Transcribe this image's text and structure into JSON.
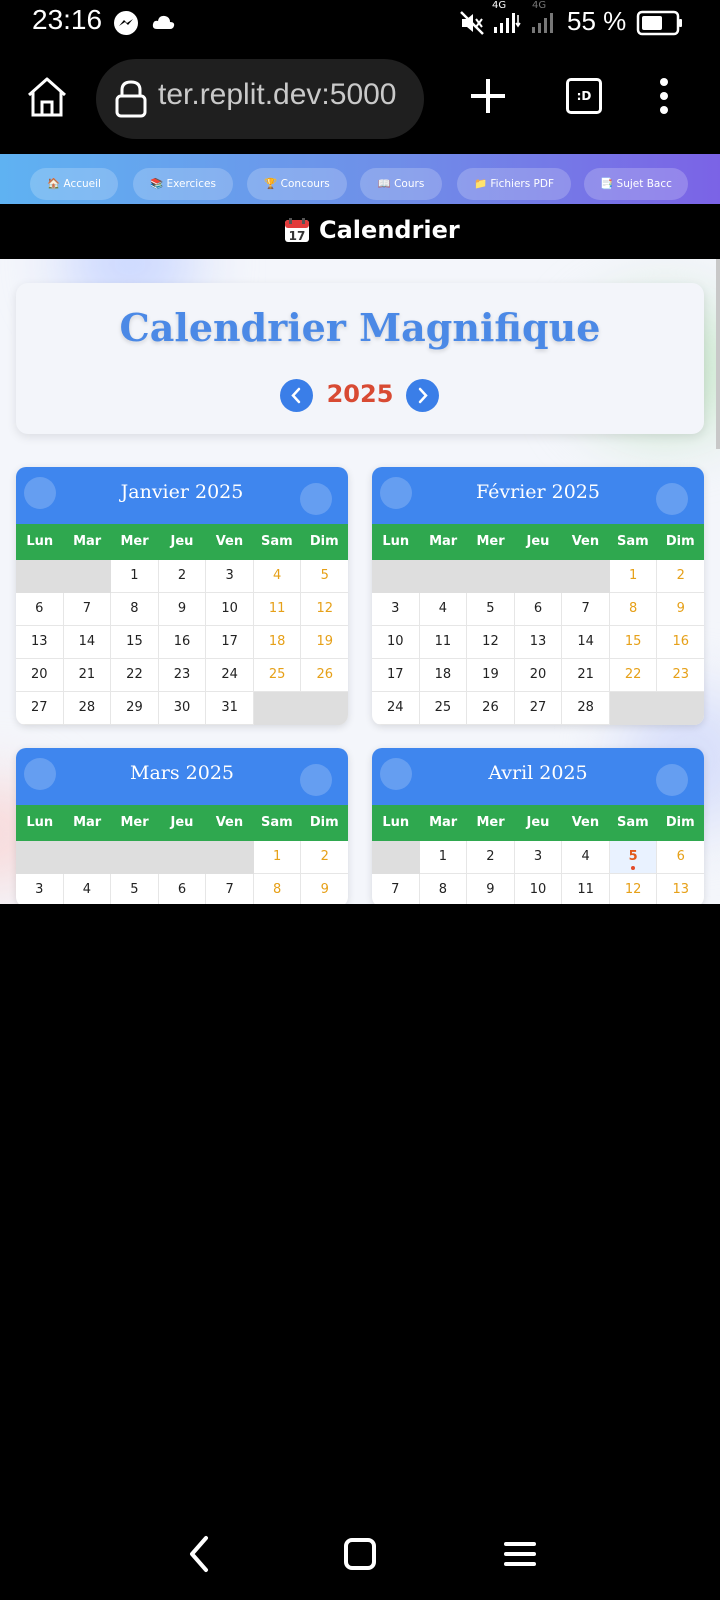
{
  "status_bar": {
    "time": "23:16",
    "battery_text": "55 %",
    "network_label_1": "4G",
    "network_label_2": "4G",
    "icons": [
      "messenger-icon",
      "cloud-icon",
      "mute-icon",
      "signal-icon",
      "battery-icon"
    ]
  },
  "browser": {
    "url": "ter.replit.dev:5000",
    "tabs_label": ":D",
    "icons": [
      "home-icon",
      "lock-icon",
      "plus-icon",
      "menu-dots-icon"
    ]
  },
  "site_nav": {
    "items": [
      {
        "label": "🏠 Accueil"
      },
      {
        "label": "📚 Exercices"
      },
      {
        "label": "🏆 Concours"
      },
      {
        "label": "📖 Cours"
      },
      {
        "label": "📁 Fichiers PDF"
      },
      {
        "label": "📑 Sujet Bacc"
      }
    ]
  },
  "page_title": "Calendrier",
  "calendar": {
    "title": "Calendrier Magnifique",
    "year": "2025",
    "weekdays": [
      "Lun",
      "Mar",
      "Mer",
      "Jeu",
      "Ven",
      "Sam",
      "Dim"
    ],
    "today_marker": {
      "month_index": 3,
      "day": "5"
    },
    "months": [
      {
        "name": "Janvier 2025",
        "weeks": [
          [
            "",
            "",
            "1",
            "2",
            "3",
            "4",
            "5"
          ],
          [
            "6",
            "7",
            "8",
            "9",
            "10",
            "11",
            "12"
          ],
          [
            "13",
            "14",
            "15",
            "16",
            "17",
            "18",
            "19"
          ],
          [
            "20",
            "21",
            "22",
            "23",
            "24",
            "25",
            "26"
          ],
          [
            "27",
            "28",
            "29",
            "30",
            "31",
            "",
            ""
          ]
        ]
      },
      {
        "name": "Février 2025",
        "weeks": [
          [
            "",
            "",
            "",
            "",
            "",
            "1",
            "2"
          ],
          [
            "3",
            "4",
            "5",
            "6",
            "7",
            "8",
            "9"
          ],
          [
            "10",
            "11",
            "12",
            "13",
            "14",
            "15",
            "16"
          ],
          [
            "17",
            "18",
            "19",
            "20",
            "21",
            "22",
            "23"
          ],
          [
            "24",
            "25",
            "26",
            "27",
            "28",
            "",
            ""
          ]
        ]
      },
      {
        "name": "Mars 2025",
        "weeks": [
          [
            "",
            "",
            "",
            "",
            "",
            "1",
            "2"
          ],
          [
            "3",
            "4",
            "5",
            "6",
            "7",
            "8",
            "9"
          ]
        ]
      },
      {
        "name": "Avril 2025",
        "weeks": [
          [
            "",
            "1",
            "2",
            "3",
            "4",
            "5",
            "6"
          ],
          [
            "7",
            "8",
            "9",
            "10",
            "11",
            "12",
            "13"
          ]
        ]
      }
    ]
  },
  "colors": {
    "month_header": "#3f86ee",
    "weekday_row": "#2fa84f",
    "weekend_text": "#e6a018",
    "year_text": "#d84a33",
    "title_text": "#4b89e6"
  }
}
